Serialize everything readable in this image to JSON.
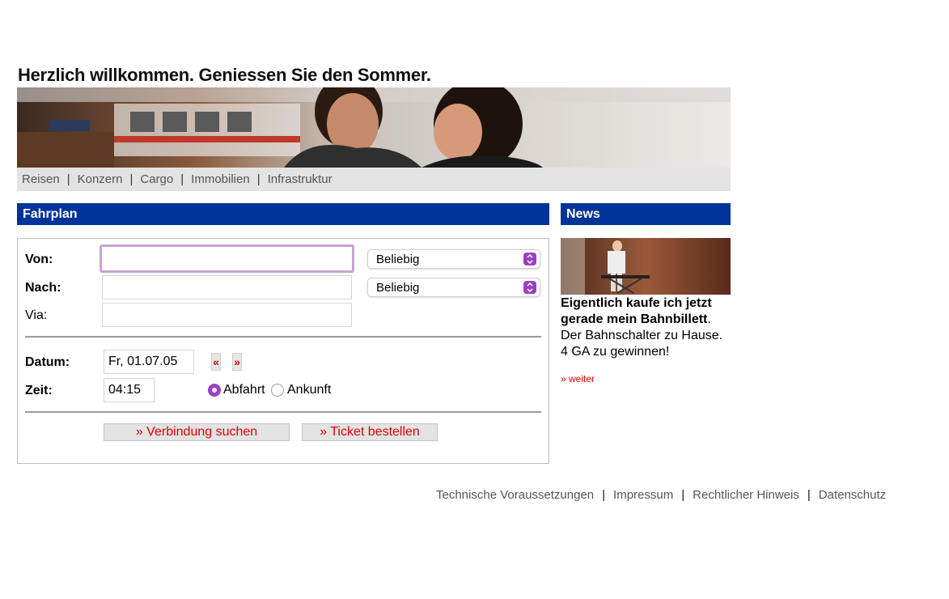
{
  "headline": "Herzlich willkommen. Geniessen Sie den Sommer.",
  "topnav": [
    "Reisen",
    "Konzern",
    "Cargo",
    "Immobilien",
    "Infrastruktur"
  ],
  "topnav_separator": "|",
  "fahrplan": {
    "title": "Fahrplan",
    "von_label": "Von:",
    "nach_label": "Nach:",
    "via_label": "Via:",
    "von_value": "",
    "nach_value": "",
    "via_value": "",
    "von_select": "Beliebig",
    "nach_select": "Beliebig",
    "datum_label": "Datum:",
    "datum_value": "Fr, 01.07.05",
    "prev_label": "«",
    "next_label": "»",
    "zeit_label": "Zeit:",
    "zeit_value": "04:15",
    "abfahrt_label": "Abfahrt",
    "ankunft_label": "Ankunft",
    "search_button": "» Verbindung suchen",
    "ticket_button": "» Ticket bestellen"
  },
  "news": {
    "title": "News",
    "headline_bold": "Eigentlich kaufe ich jetzt gerade mein Bahnbillett",
    "headline_end": ".",
    "line1": "Der Bahnschalter zu Hause.",
    "line2": "4 GA zu gewinnen!",
    "more": "» weiter"
  },
  "footer": [
    "Technische Voraussetzungen",
    "Impressum",
    "Rechtlicher Hinweis",
    "Datenschutz"
  ],
  "footer_separator": "|",
  "colors": {
    "header_blue": "#003399",
    "link_red": "#e00000",
    "accent_purple": "#9b3fc0",
    "nav_gray": "#e3e3e3"
  },
  "icons": [
    "select-arrows-icon",
    "radio-selected-icon",
    "radio-unselected-icon"
  ]
}
